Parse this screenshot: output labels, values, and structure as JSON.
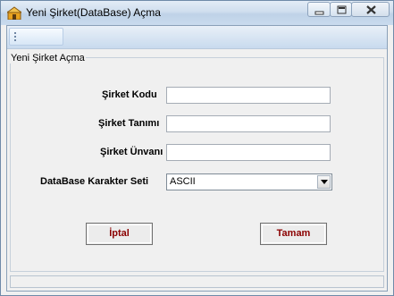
{
  "window": {
    "title": "Yeni Şirket(DataBase) Açma",
    "icon": "home-icon"
  },
  "group": {
    "legend": "Yeni Şirket Açma"
  },
  "form": {
    "company_code_label": "Şirket Kodu",
    "company_code_value": "",
    "company_desc_label": "Şirket Tanımı",
    "company_desc_value": "",
    "company_title_label": "Şirket Ünvanı",
    "company_title_value": "",
    "charset_label": "DataBase Karakter Seti",
    "charset_value": "ASCII"
  },
  "buttons": {
    "cancel_label": "İptal",
    "ok_label": "Tamam"
  },
  "colors": {
    "button_text": "#8b0000",
    "title_bar": "#cfdeee"
  }
}
